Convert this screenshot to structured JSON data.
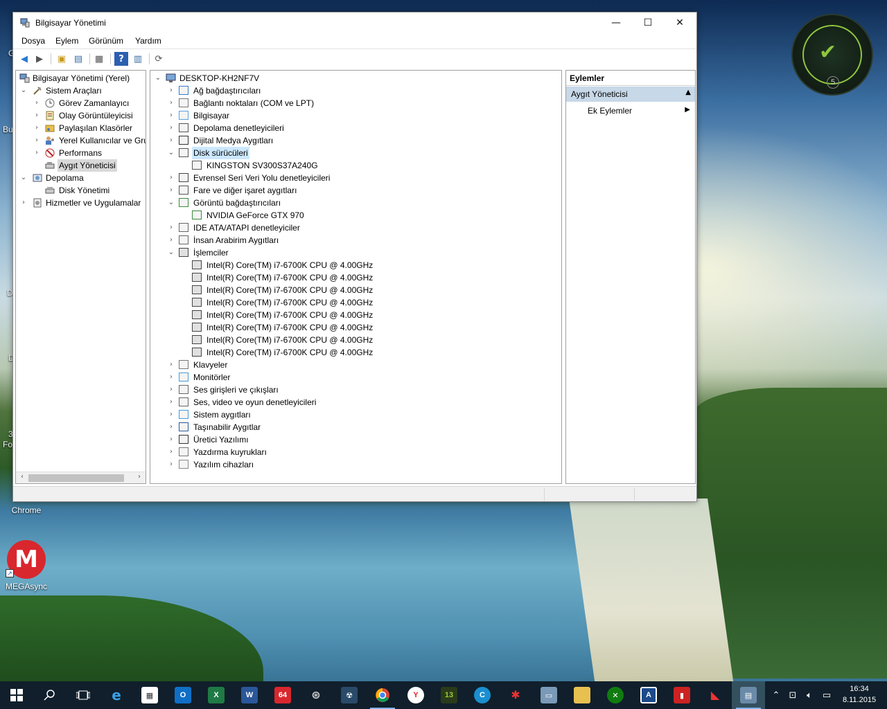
{
  "desktop": {
    "icons": [
      {
        "label": "Chrome"
      },
      {
        "label": "MEGAsync"
      }
    ],
    "partial_labels": [
      "G",
      "Bu",
      "D",
      "D",
      "3",
      "Fot"
    ],
    "widget_number": "5",
    "mega_letter": "M"
  },
  "window": {
    "title": "Bilgisayar Yönetimi",
    "controls": {
      "minimize": "—",
      "maximize": "☐",
      "close": "✕"
    },
    "menu": [
      "Dosya",
      "Eylem",
      "Görünüm",
      "Yardım"
    ]
  },
  "left_tree": [
    {
      "label": "Bilgisayar Yönetimi (Yerel)",
      "icon": "computer-management-icon"
    },
    {
      "label": "Sistem Araçları",
      "icon": "system-tools-icon"
    },
    {
      "label": "Görev Zamanlayıcı",
      "icon": "task-scheduler-icon"
    },
    {
      "label": "Olay Görüntüleyicisi",
      "icon": "event-viewer-icon"
    },
    {
      "label": "Paylaşılan Klasörler",
      "icon": "shared-folders-icon"
    },
    {
      "label": "Yerel Kullanıcılar ve Gru",
      "icon": "local-users-icon"
    },
    {
      "label": "Performans",
      "icon": "performance-icon"
    },
    {
      "label": "Aygıt Yöneticisi",
      "icon": "device-manager-icon"
    },
    {
      "label": "Depolama",
      "icon": "storage-icon"
    },
    {
      "label": "Disk Yönetimi",
      "icon": "disk-management-icon"
    },
    {
      "label": "Hizmetler ve Uygulamalar",
      "icon": "services-icon"
    }
  ],
  "device_tree": {
    "root": "DESKTOP-KH2NF7V",
    "items": [
      "Ağ bağdaştırıcıları",
      "Bağlantı noktaları (COM ve LPT)",
      "Bilgisayar",
      "Depolama denetleyicileri",
      "Dijital Medya Aygıtları",
      "Disk sürücüleri",
      "KINGSTON SV300S37A240G",
      "Evrensel Seri Veri Yolu denetleyicileri",
      "Fare ve diğer işaret aygıtları",
      "Görüntü bağdaştırıcıları",
      "NVIDIA GeForce GTX 970",
      "IDE ATA/ATAPI denetleyiciler",
      "İnsan Arabirim Aygıtları",
      "İşlemciler",
      "Intel(R) Core(TM) i7-6700K CPU @ 4.00GHz",
      "Intel(R) Core(TM) i7-6700K CPU @ 4.00GHz",
      "Intel(R) Core(TM) i7-6700K CPU @ 4.00GHz",
      "Intel(R) Core(TM) i7-6700K CPU @ 4.00GHz",
      "Intel(R) Core(TM) i7-6700K CPU @ 4.00GHz",
      "Intel(R) Core(TM) i7-6700K CPU @ 4.00GHz",
      "Intel(R) Core(TM) i7-6700K CPU @ 4.00GHz",
      "Intel(R) Core(TM) i7-6700K CPU @ 4.00GHz",
      "Klavyeler",
      "Monitörler",
      "Ses girişleri ve çıkışları",
      "Ses, video ve oyun denetleyicileri",
      "Sistem aygıtları",
      "Taşınabilir Aygıtlar",
      "Üretici Yazılımı",
      "Yazdırma kuyrukları",
      "Yazılım cihazları"
    ]
  },
  "actions_pane": {
    "header": "Eylemler",
    "group": "Aygıt Yöneticisi",
    "item": "Ek Eylemler"
  },
  "taskbar": {
    "badge_64": "64",
    "badge_13": "13",
    "clock_time": "16:34",
    "clock_date": "8.11.2015"
  },
  "colors": {
    "selection_blue": "#cce8ff",
    "actions_group_bg": "#c7d8e8",
    "taskbar_bg": "#101f2b",
    "widget_green": "#8ec63f"
  }
}
